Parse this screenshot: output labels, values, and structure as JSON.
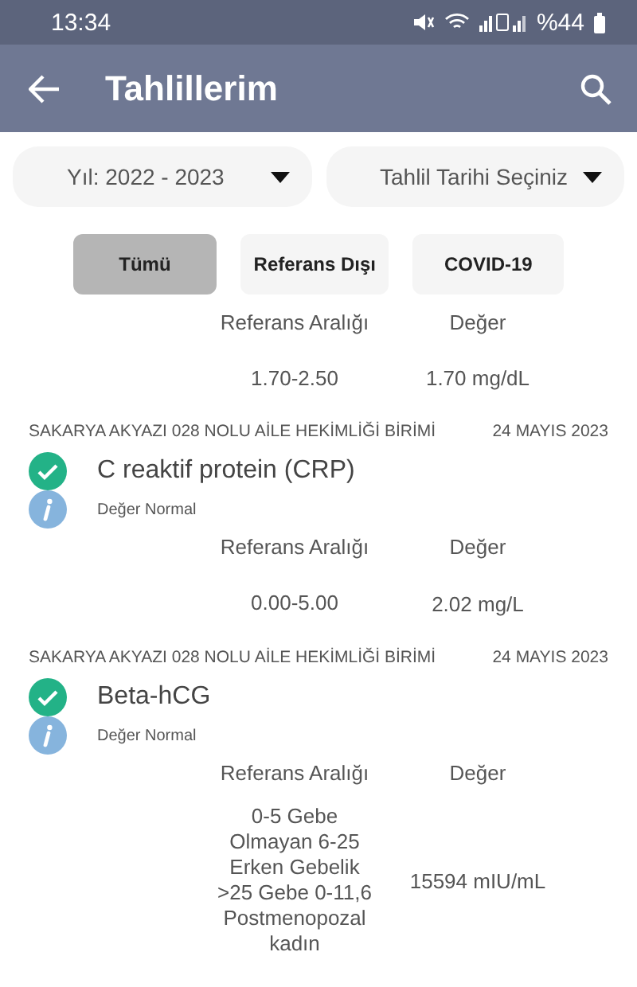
{
  "status_bar": {
    "time": "13:34",
    "battery": "%44"
  },
  "app_bar": {
    "title": "Tahlillerim"
  },
  "filters": [
    {
      "value": "Yıl: 2022 - 2023"
    },
    {
      "value": "Tahlil Tarihi Seçiniz"
    }
  ],
  "chips": [
    {
      "label": "Tümü",
      "selected": true
    },
    {
      "label": "Referans Dışı",
      "selected": false
    },
    {
      "label": "COVID-19",
      "selected": false
    }
  ],
  "partial_result": {
    "range_header": "Referans Aralığı",
    "value_header": "Değer",
    "range": "1.70-2.50",
    "value": "1.70 mg/dL"
  },
  "results": [
    {
      "facility": "SAKARYA AKYAZI 028 NOLU AİLE HEKİMLİĞİ BİRİMİ",
      "date": "24 MAYIS 2023",
      "name": "C reaktif protein (CRP)",
      "in_range": true,
      "note": "Değer Normal",
      "range_header": "Referans Aralığı",
      "value_header": "Değer",
      "range": "0.00-5.00",
      "value": "2.02 mg/L"
    },
    {
      "facility": "SAKARYA AKYAZI 028 NOLU AİLE HEKİMLİĞİ BİRİMİ",
      "date": "24 MAYIS 2023",
      "name": "Beta-hCG",
      "in_range": true,
      "note": "Değer Normal",
      "range_header": "Referans Aralığı",
      "value_header": "Değer",
      "range": "0-5 Gebe Olmayan 6-25 Erken Gebelik >25 Gebe 0-11,6 Postmenopozal kadın",
      "value": "15594 mIU/mL"
    }
  ]
}
